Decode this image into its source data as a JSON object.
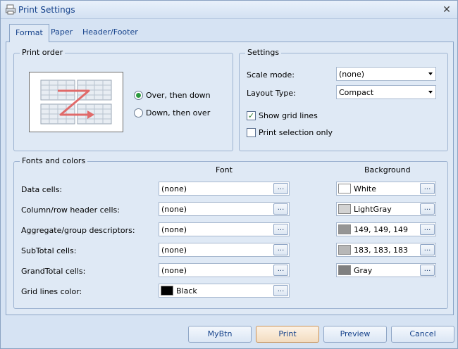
{
  "window": {
    "title": "Print Settings",
    "title_icon": "printer-icon",
    "close_icon": "close-icon"
  },
  "tabs": [
    {
      "label": "Format",
      "active": true
    },
    {
      "label": "Paper",
      "active": false
    },
    {
      "label": "Header/Footer",
      "active": false
    }
  ],
  "print_order": {
    "group_title": "Print order",
    "options": [
      {
        "label": "Over, then down",
        "checked": true
      },
      {
        "label": "Down, then over",
        "checked": false
      }
    ]
  },
  "settings": {
    "group_title": "Settings",
    "scale_mode_label": "Scale mode:",
    "scale_mode_value": "(none)",
    "layout_type_label": "Layout Type:",
    "layout_type_value": "Compact",
    "show_grid_lines_label": "Show grid lines",
    "show_grid_lines_checked": true,
    "print_selection_label": "Print selection only",
    "print_selection_checked": false
  },
  "fonts_colors": {
    "group_title": "Fonts and colors",
    "font_header": "Font",
    "background_header": "Background",
    "dots_label": "...",
    "rows": [
      {
        "label": "Data cells:",
        "font": "(none)",
        "bg_name": "White",
        "bg_color": "#ffffff"
      },
      {
        "label": "Column/row header cells:",
        "font": "(none)",
        "bg_name": "LightGray",
        "bg_color": "#d3d3d3"
      },
      {
        "label": "Aggregate/group descriptors:",
        "font": "(none)",
        "bg_name": "149, 149, 149",
        "bg_color": "#959595"
      },
      {
        "label": "SubTotal cells:",
        "font": "(none)",
        "bg_name": "183, 183, 183",
        "bg_color": "#b7b7b7"
      },
      {
        "label": "GrandTotal cells:",
        "font": "(none)",
        "bg_name": "Gray",
        "bg_color": "#808080"
      }
    ],
    "grid_lines": {
      "label": "Grid lines color:",
      "color_name": "Black",
      "color": "#000000"
    }
  },
  "buttons": {
    "mybtn": "MyBtn",
    "print": "Print",
    "preview": "Preview",
    "cancel": "Cancel"
  }
}
